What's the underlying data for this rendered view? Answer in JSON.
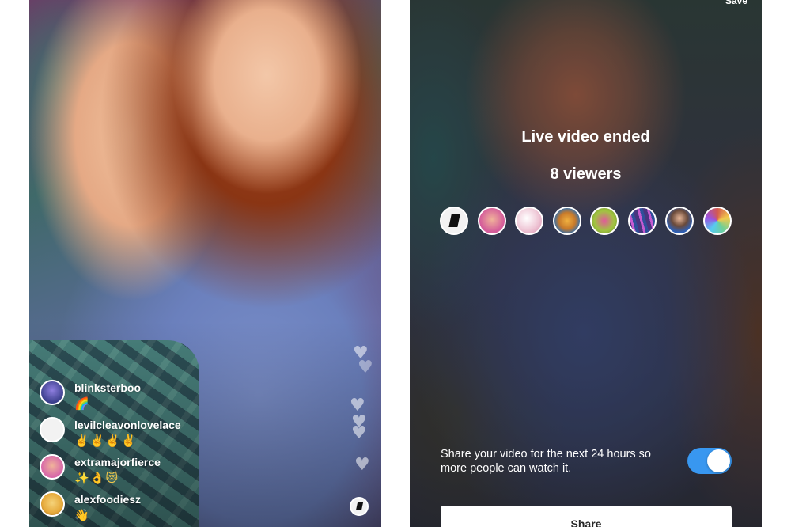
{
  "left_screen": {
    "comments": [
      {
        "username": "blinksterboo",
        "text": "🌈",
        "avatar_color": "#3b3f8c"
      },
      {
        "username": "levilcleavonlovelace",
        "text": "✌️✌️✌️✌️",
        "avatar_color": "#f2f2f2"
      },
      {
        "username": "extramajorfierce",
        "text": "✨👌😻",
        "avatar_color": "#d86aa8"
      },
      {
        "username": "alexfoodiesz",
        "text": "👋",
        "avatar_color": "#e6a93a"
      }
    ],
    "heart_icon": "heart-icon"
  },
  "right_screen": {
    "save_label": "Save",
    "title": "Live video ended",
    "viewer_count": "8 viewers",
    "viewer_avatar_colors": [
      "#f2f2f2",
      "#d45c9a",
      "#efc7d6",
      "#2e6fb0",
      "#a1c441",
      "#48357f",
      "#2f5fb3",
      "#d4584f"
    ],
    "share_text": "Share your video for the next 24 hours so more people can watch it.",
    "share_toggle_on": true,
    "accent_color": "#3897f0",
    "share_button_label": "Share"
  }
}
